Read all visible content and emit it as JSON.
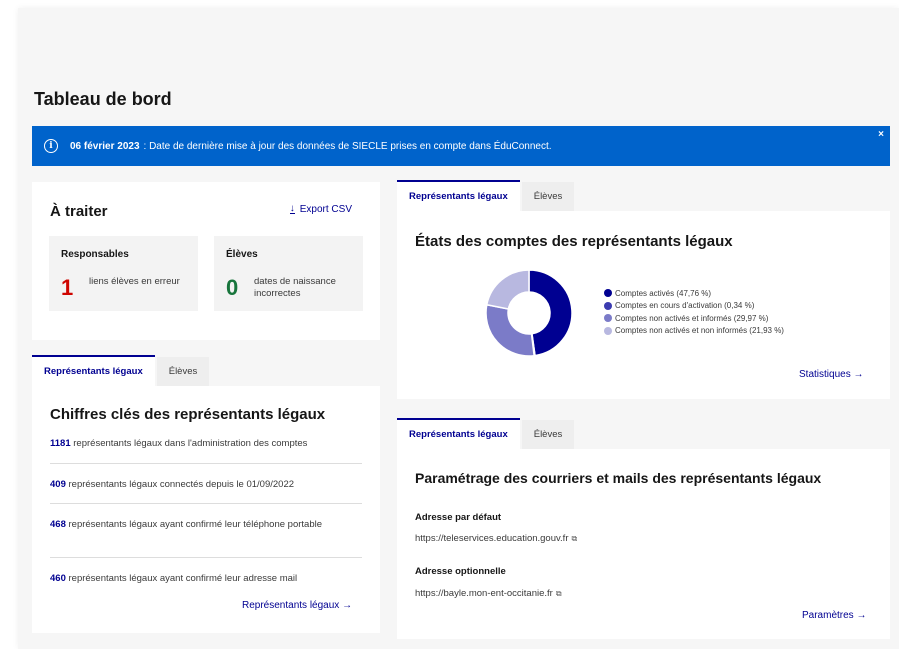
{
  "page_title": "Tableau de bord",
  "banner": {
    "date": "06 février 2023",
    "text": " : Date de dernière mise à jour des données de SIECLE prises en compte dans ÉduConnect.",
    "close": "×"
  },
  "a_traiter": {
    "title": "À traiter",
    "export_label": "Export CSV",
    "responsables": {
      "title": "Responsables",
      "count": "1",
      "desc": "liens élèves en erreur"
    },
    "eleves": {
      "title": "Élèves",
      "count": "0",
      "desc": "dates de naissance incorrectes"
    }
  },
  "tabs_left": {
    "active": "Représentants légaux",
    "inactive": "Élèves"
  },
  "chiffres": {
    "title": "Chiffres clés des représentants légaux",
    "stats": [
      {
        "num": "1181",
        "text": " représentants légaux dans l'administration des comptes"
      },
      {
        "num": "409",
        "text": " représentants légaux connectés depuis le 01/09/2022"
      },
      {
        "num": "468",
        "text": " représentants légaux ayant confirmé leur téléphone portable"
      },
      {
        "num": "460",
        "text": " représentants légaux ayant confirmé leur adresse mail"
      }
    ],
    "link": "Représentants légaux"
  },
  "tabs_right_top": {
    "active": "Représentants légaux",
    "inactive": "Élèves"
  },
  "etats": {
    "title": "États des comptes des représentants légaux",
    "link": "Statistiques"
  },
  "chart_data": {
    "type": "pie",
    "categories": [
      "Comptes activés (47,76 %)",
      "Comptes en cours d'activation (0,34 %)",
      "Comptes non activés et informés (29,97 %)",
      "Comptes non activés et non informés (21,93 %)"
    ],
    "values": [
      47.76,
      0.34,
      29.97,
      21.93
    ],
    "colors": [
      "#000091",
      "#3b3bb0",
      "#7b7bc8",
      "#b8b8e0"
    ],
    "title": "États des comptes des représentants légaux",
    "legend": "right"
  },
  "tabs_right_bottom": {
    "active": "Représentants légaux",
    "inactive": "Élèves"
  },
  "param": {
    "title": "Paramétrage des courriers et mails des représentants légaux",
    "default_label": "Adresse par défaut",
    "default_url": "https://teleservices.education.gouv.fr",
    "optional_label": "Adresse optionnelle",
    "optional_url": "https://bayle.mon-ent-occitanie.fr",
    "link": "Paramètres"
  },
  "icons": {
    "info": "info-icon",
    "download": "download-icon",
    "external": "external-link-icon",
    "arrow": "arrow-right-icon",
    "close": "close-icon"
  }
}
